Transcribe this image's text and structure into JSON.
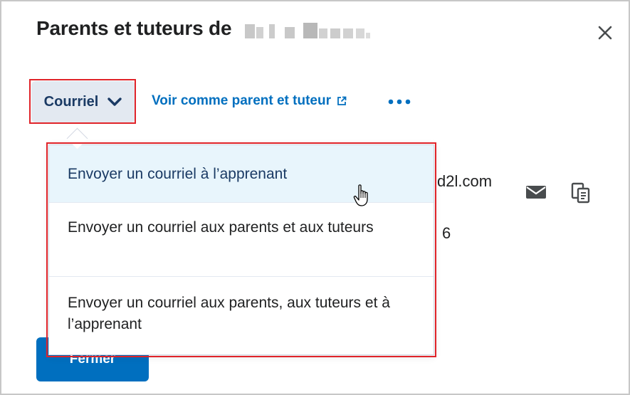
{
  "dialog": {
    "title": "Parents et tuteurs de",
    "close_icon": "close-icon"
  },
  "toolbar": {
    "courriel_label": "Courriel",
    "voir_label": "Voir comme parent et tuteur",
    "external_icon": "external-link-icon",
    "more_icon": "more-options-icon"
  },
  "menu": {
    "items": [
      {
        "label": "Envoyer un courriel à l’apprenant"
      },
      {
        "label": "Envoyer un courriel aux parents et aux tuteurs"
      },
      {
        "label": "Envoyer un courriel aux parents, aux tuteurs et à l’apprenant"
      }
    ]
  },
  "background": {
    "email_fragment": "d2l.com",
    "number_fragment": "6",
    "mail_icon": "mail-icon",
    "copy_icon": "copy-icon"
  },
  "footer": {
    "fermer_label": "Fermer"
  },
  "colors": {
    "accent": "#006fbf",
    "highlight_outline": "#e0242a",
    "menu_hover": "#e8f5fc"
  }
}
